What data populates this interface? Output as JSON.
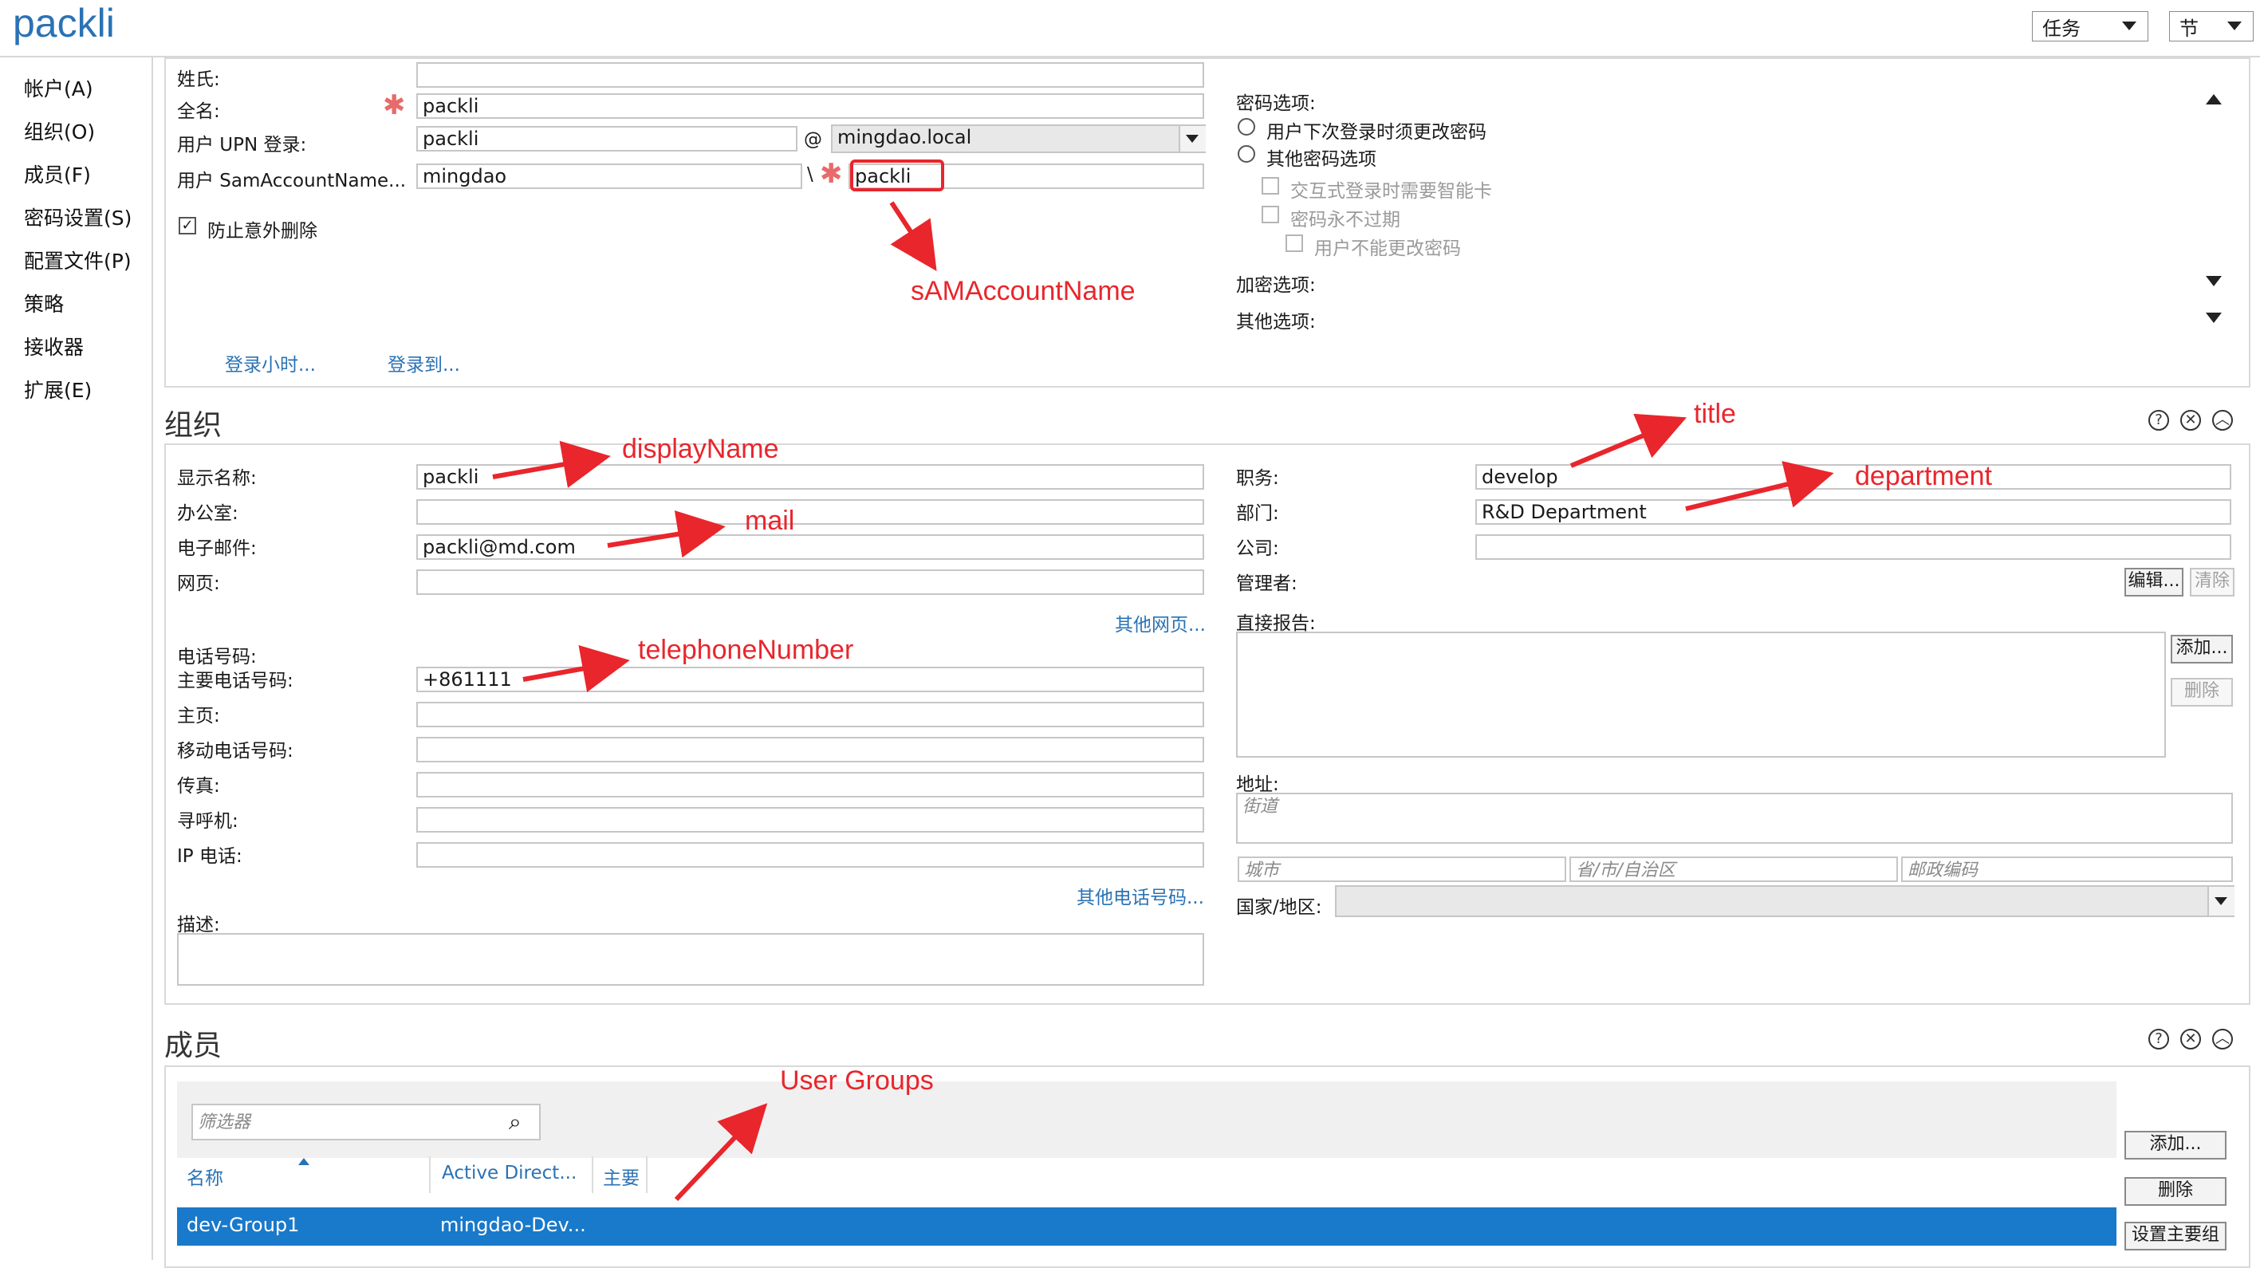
{
  "app": {
    "title": "packli"
  },
  "topbar": {
    "tasks_label": "任务",
    "sections_label": "节"
  },
  "sidebar": {
    "items": [
      "帐户(A)",
      "组织(O)",
      "成员(F)",
      "密码设置(S)",
      "配置文件(P)",
      "策略",
      "接收器",
      "扩展(E)"
    ]
  },
  "account": {
    "surname_label": "姓氏:",
    "surname_value": "",
    "fullname_label": "全名:",
    "fullname_value": "packli",
    "upn_label": "用户 UPN 登录:",
    "upn_value": "packli",
    "upn_at": "@",
    "upn_domain": "mingdao.local",
    "sam_label": "用户 SamAccountName...",
    "sam_domain": "mingdao",
    "sam_sep": "\\",
    "sam_value": "packli",
    "protect_label": "防止意外删除",
    "logon_hours_link": "登录小时...",
    "logon_to_link": "登录到...",
    "password_options_label": "密码选项:",
    "pw_radio_1": "用户下次登录时须更改密码",
    "pw_radio_2": "其他密码选项",
    "pw_chk_smartcard": "交互式登录时需要智能卡",
    "pw_chk_never_expire": "密码永不过期",
    "pw_chk_cannot_change": "用户不能更改密码",
    "encryption_label": "加密选项:",
    "other_options_label": "其他选项:"
  },
  "org": {
    "title": "组织",
    "display_name_label": "显示名称:",
    "display_name_value": "packli",
    "office_label": "办公室:",
    "office_value": "",
    "email_label": "电子邮件:",
    "email_value": "packli@md.com",
    "webpage_label": "网页:",
    "webpage_value": "",
    "other_webpages_link": "其他网页...",
    "phone_header": "电话号码:",
    "main_phone_label": "主要电话号码:",
    "main_phone_value": "+861111",
    "home_label": "主页:",
    "mobile_label": "移动电话号码:",
    "fax_label": "传真:",
    "pager_label": "寻呼机:",
    "ip_phone_label": "IP 电话:",
    "other_phones_link": "其他电话号码...",
    "description_label": "描述:",
    "job_title_label": "职务:",
    "job_title_value": "develop",
    "department_label": "部门:",
    "department_value": "R&D Department",
    "company_label": "公司:",
    "company_value": "",
    "manager_label": "管理者:",
    "edit_button": "编辑...",
    "clear_button": "清除",
    "direct_reports_label": "直接报告:",
    "add_button": "添加...",
    "remove_button": "删除",
    "address_label": "地址:",
    "street_ph": "街道",
    "city_ph": "城市",
    "state_ph": "省/市/自治区",
    "zip_ph": "邮政编码",
    "country_label": "国家/地区:"
  },
  "members": {
    "title": "成员",
    "filter_ph": "筛选器",
    "columns": [
      "名称",
      "Active Direct...",
      "主要"
    ],
    "rows": [
      {
        "name": "dev-Group1",
        "domain": "mingdao-Dev..."
      }
    ],
    "add_button": "添加...",
    "remove_button": "删除",
    "set_primary_button": "设置主要组"
  },
  "annotations": {
    "sam": "sAMAccountName",
    "display_name": "displayName",
    "mail": "mail",
    "telephone": "telephoneNumber",
    "title": "title",
    "department": "department",
    "groups": "User Groups"
  },
  "colors": {
    "accent": "#2a72b5",
    "annotation": "#e8262c",
    "selection": "#1979ca"
  }
}
